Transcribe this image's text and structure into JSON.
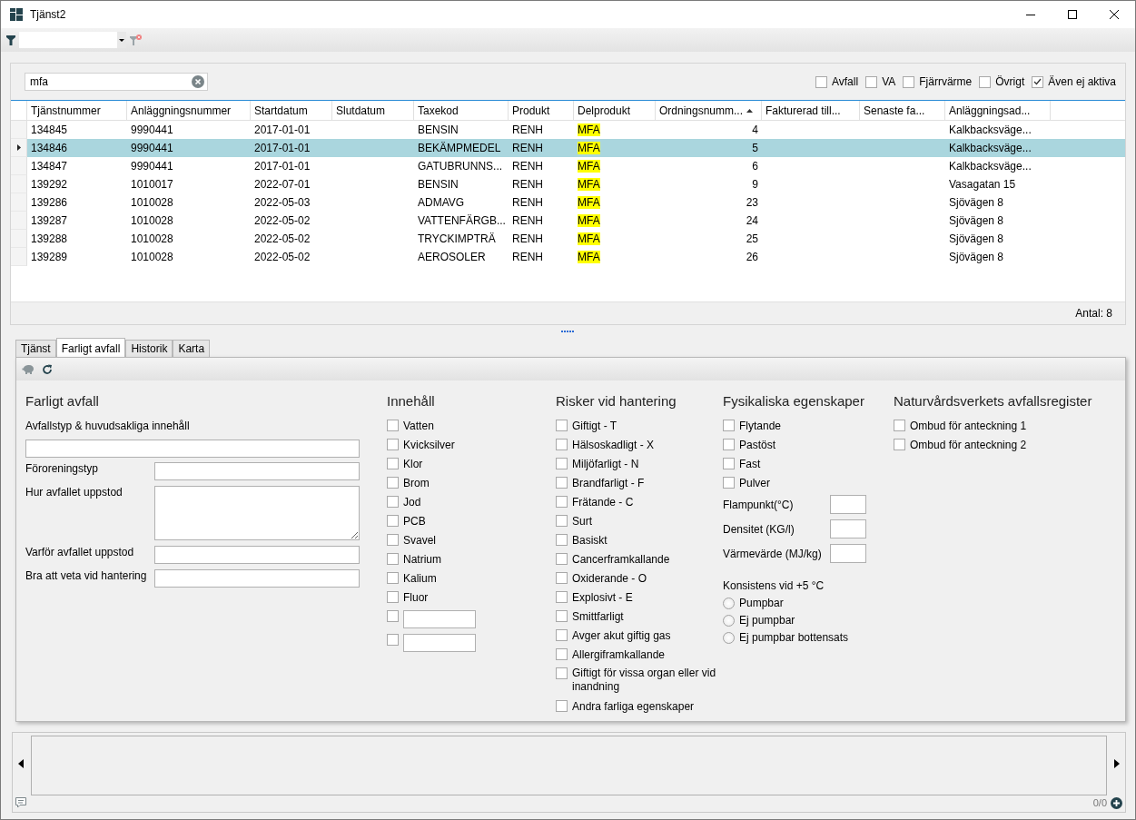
{
  "window": {
    "title": "Tjänst2"
  },
  "search": {
    "value": "mfa"
  },
  "filters": [
    {
      "label": "Avfall",
      "checked": false
    },
    {
      "label": "VA",
      "checked": false
    },
    {
      "label": "Fjärrvärme",
      "checked": false
    },
    {
      "label": "Övrigt",
      "checked": false
    },
    {
      "label": "Även ej aktiva",
      "checked": true
    }
  ],
  "table": {
    "columns": [
      {
        "label": "Tjänstnummer",
        "kind": "text",
        "sorted": false
      },
      {
        "label": "Anläggningsnummer",
        "kind": "text",
        "sorted": false
      },
      {
        "label": "Startdatum",
        "kind": "text",
        "sorted": false
      },
      {
        "label": "Slutdatum",
        "kind": "text",
        "sorted": false
      },
      {
        "label": "Taxekod",
        "kind": "text",
        "sorted": false
      },
      {
        "label": "Produkt",
        "kind": "text",
        "sorted": false
      },
      {
        "label": "Delprodukt",
        "kind": "match",
        "sorted": false
      },
      {
        "label": "Ordningsnumm...",
        "kind": "number",
        "sorted": true
      },
      {
        "label": "Fakturerad till...",
        "kind": "text",
        "sorted": false
      },
      {
        "label": "Senaste fa...",
        "kind": "text",
        "sorted": false
      },
      {
        "label": "Anläggningsad...",
        "kind": "text",
        "sorted": false
      }
    ],
    "rows": [
      {
        "selected": false,
        "cells": [
          "134845",
          "9990441",
          "2017-01-01",
          "",
          "BENSIN",
          "RENH",
          "MFA",
          "4",
          "",
          "",
          "Kalkbacksväge..."
        ]
      },
      {
        "selected": true,
        "cells": [
          "134846",
          "9990441",
          "2017-01-01",
          "",
          "BEKÄMPMEDEL",
          "RENH",
          "MFA",
          "5",
          "",
          "",
          "Kalkbacksväge..."
        ]
      },
      {
        "selected": false,
        "cells": [
          "134847",
          "9990441",
          "2017-01-01",
          "",
          "GATUBRUNNS...",
          "RENH",
          "MFA",
          "6",
          "",
          "",
          "Kalkbacksväge..."
        ]
      },
      {
        "selected": false,
        "cells": [
          "139292",
          "1010017",
          "2022-07-01",
          "",
          "BENSIN",
          "RENH",
          "MFA",
          "9",
          "",
          "",
          "Vasagatan 15"
        ]
      },
      {
        "selected": false,
        "cells": [
          "139286",
          "1010028",
          "2022-05-03",
          "",
          "ADMAVG",
          "RENH",
          "MFA",
          "23",
          "",
          "",
          "Sjövägen 8"
        ]
      },
      {
        "selected": false,
        "cells": [
          "139287",
          "1010028",
          "2022-05-02",
          "",
          "VATTENFÄRGB...",
          "RENH",
          "MFA",
          "24",
          "",
          "",
          "Sjövägen 8"
        ]
      },
      {
        "selected": false,
        "cells": [
          "139288",
          "1010028",
          "2022-05-02",
          "",
          "TRYCKIMPTRÄ",
          "RENH",
          "MFA",
          "25",
          "",
          "",
          "Sjövägen 8"
        ]
      },
      {
        "selected": false,
        "cells": [
          "139289",
          "1010028",
          "2022-05-02",
          "",
          "AEROSOLER",
          "RENH",
          "MFA",
          "26",
          "",
          "",
          "Sjövägen 8"
        ]
      }
    ],
    "footer": "Antal: 8"
  },
  "tabs": [
    {
      "label": "Tjänst",
      "selected": false
    },
    {
      "label": "Farligt avfall",
      "selected": true
    },
    {
      "label": "Historik",
      "selected": false
    },
    {
      "label": "Karta",
      "selected": false
    }
  ],
  "form": {
    "waste": {
      "title": "Farligt avfall",
      "type_label": "Avfallstyp & huvudsakliga innehåll",
      "fields": [
        {
          "label": "Föroreningstyp",
          "kind": "text"
        },
        {
          "label": "Hur avfallet uppstod",
          "kind": "textarea"
        },
        {
          "label": "Varför avfallet uppstod",
          "kind": "text"
        },
        {
          "label": "Bra att veta vid hantering",
          "kind": "text"
        }
      ]
    },
    "contents": {
      "title": "Innehåll",
      "items": [
        {
          "kind": "checkbox",
          "label": "Vatten",
          "checked": false
        },
        {
          "kind": "checkbox",
          "label": "Kvicksilver",
          "checked": false
        },
        {
          "kind": "checkbox",
          "label": "Klor",
          "checked": false
        },
        {
          "kind": "checkbox",
          "label": "Brom",
          "checked": false
        },
        {
          "kind": "checkbox",
          "label": "Jod",
          "checked": false
        },
        {
          "kind": "checkbox",
          "label": "PCB",
          "checked": false
        },
        {
          "kind": "checkbox",
          "label": "Svavel",
          "checked": false
        },
        {
          "kind": "checkbox",
          "label": "Natrium",
          "checked": false
        },
        {
          "kind": "checkbox",
          "label": "Kalium",
          "checked": false
        },
        {
          "kind": "checkbox",
          "label": "Fluor",
          "checked": false
        },
        {
          "kind": "checkbox-input",
          "checked": false
        },
        {
          "kind": "checkbox-input",
          "checked": false
        }
      ]
    },
    "risks": {
      "title": "Risker vid hantering",
      "items": [
        {
          "kind": "checkbox",
          "label": "Giftigt - T",
          "checked": false
        },
        {
          "kind": "checkbox",
          "label": "Hälsoskadligt - X",
          "checked": false
        },
        {
          "kind": "checkbox",
          "label": "Miljöfarligt - N",
          "checked": false
        },
        {
          "kind": "checkbox",
          "label": "Brandfarligt - F",
          "checked": false
        },
        {
          "kind": "checkbox",
          "label": "Frätande - C",
          "checked": false
        },
        {
          "kind": "checkbox",
          "label": "Surt",
          "checked": false
        },
        {
          "kind": "checkbox",
          "label": "Basiskt",
          "checked": false
        },
        {
          "kind": "checkbox",
          "label": "Cancerframkallande",
          "checked": false
        },
        {
          "kind": "checkbox",
          "label": "Oxiderande - O",
          "checked": false
        },
        {
          "kind": "checkbox",
          "label": "Explosivt - E",
          "checked": false
        },
        {
          "kind": "checkbox",
          "label": "Smittfarligt",
          "checked": false
        },
        {
          "kind": "checkbox",
          "label": "Avger akut giftig gas",
          "checked": false
        },
        {
          "kind": "checkbox",
          "label": "Allergiframkallande",
          "checked": false
        },
        {
          "kind": "checkbox",
          "label": "Giftigt för vissa organ eller vid inandning",
          "checked": false
        },
        {
          "kind": "checkbox",
          "label": "Andra farliga egenskaper",
          "checked": false
        }
      ]
    },
    "physical": {
      "title": "Fysikaliska egenskaper",
      "items": [
        {
          "kind": "checkbox",
          "label": "Flytande",
          "checked": false
        },
        {
          "kind": "checkbox",
          "label": "Pastöst",
          "checked": false
        },
        {
          "kind": "checkbox",
          "label": "Fast",
          "checked": false
        },
        {
          "kind": "checkbox",
          "label": "Pulver",
          "checked": false
        }
      ],
      "measures": [
        {
          "label": "Flampunkt(°C)"
        },
        {
          "label": "Densitet (KG/l)"
        },
        {
          "label": "Värmevärde (MJ/kg)"
        }
      ],
      "consistency": {
        "label": "Konsistens vid +5 °C",
        "options": [
          {
            "label": "Pumpbar",
            "selected": false
          },
          {
            "label": "Ej pumpbar",
            "selected": false
          },
          {
            "label": "Ej pumpbar bottensats",
            "selected": false
          }
        ]
      }
    },
    "register": {
      "title": "Naturvårdsverkets avfallsregister",
      "items": [
        {
          "kind": "checkbox",
          "label": "Ombud för anteckning 1",
          "checked": false
        },
        {
          "kind": "checkbox",
          "label": "Ombud för anteckning 2",
          "checked": false
        }
      ]
    }
  },
  "pager": {
    "count": "0/0"
  }
}
